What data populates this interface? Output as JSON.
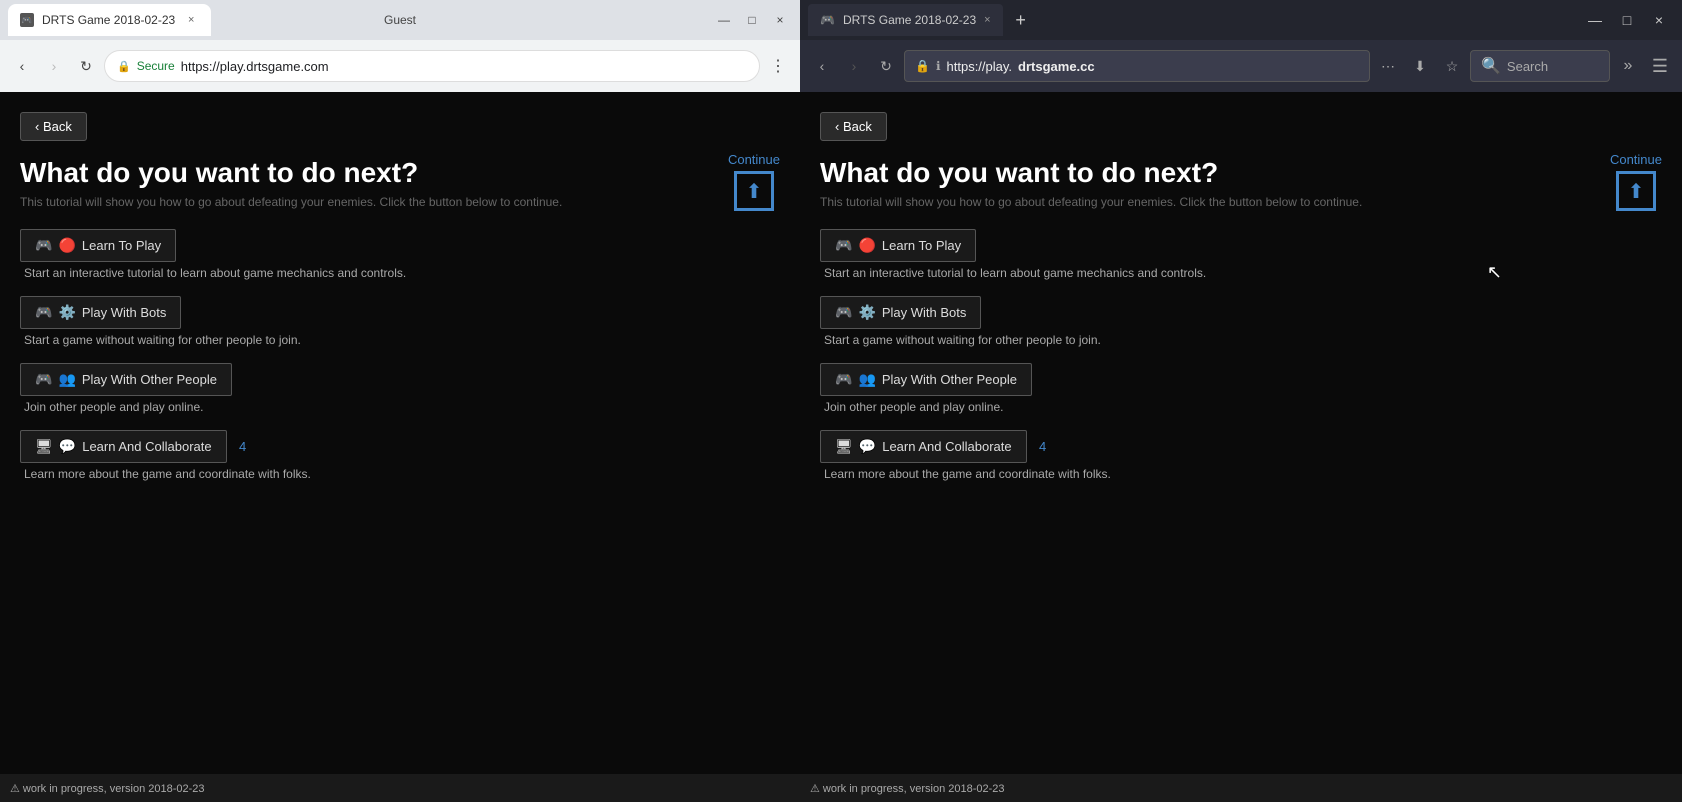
{
  "left": {
    "browser": "chrome",
    "titlebar": {
      "tab_title": "DRTS Game 2018-02-23",
      "guest_label": "Guest",
      "close": "×",
      "minimize": "—",
      "maximize": "□"
    },
    "addressbar": {
      "secure_text": "Secure",
      "url": "https://play.drtsgame.com"
    },
    "game": {
      "back_btn": "‹ Back",
      "title": "What do you want to do next?",
      "subtitle": "This tutorial will show you how to go about defeating your enemies. Click the button below to continue.",
      "continue_label": "Continue",
      "options": [
        {
          "label": "Learn To Play",
          "desc": "Start an interactive tutorial to learn about game mechanics and controls.",
          "number": ""
        },
        {
          "label": "Play With Bots",
          "desc": "Start a game without waiting for other people to join.",
          "number": ""
        },
        {
          "label": "Play With Other People",
          "desc": "Join other people and play online.",
          "number": ""
        },
        {
          "label": "Learn And Collaborate",
          "desc": "Learn more about the game and coordinate with folks.",
          "number": "4"
        }
      ]
    },
    "statusbar": "⚠ work in progress, version 2018-02-23"
  },
  "right": {
    "browser": "firefox",
    "titlebar": {
      "tab_title": "DRTS Game 2018-02-23",
      "close": "×",
      "minimize": "—",
      "maximize": "□"
    },
    "addressbar": {
      "url_prefix": "https://play.",
      "url_domain": "drtsgame.cc",
      "search_placeholder": "Search"
    },
    "game": {
      "back_btn": "‹ Back",
      "title": "What do you want to do next?",
      "subtitle": "This tutorial will show you how to go about defeating your enemies. Click the button below to continue.",
      "continue_label": "Continue",
      "options": [
        {
          "label": "Learn To Play",
          "desc": "Start an interactive tutorial to learn about game mechanics and controls.",
          "number": ""
        },
        {
          "label": "Play With Bots",
          "desc": "Start a game without waiting for other people to join.",
          "number": ""
        },
        {
          "label": "Play With Other People",
          "desc": "Join other people and play online.",
          "number": ""
        },
        {
          "label": "Learn And Collaborate",
          "desc": "Learn more about the game and coordinate with folks.",
          "number": "4"
        }
      ]
    },
    "statusbar": "⚠ work in progress, version 2018-02-23"
  }
}
